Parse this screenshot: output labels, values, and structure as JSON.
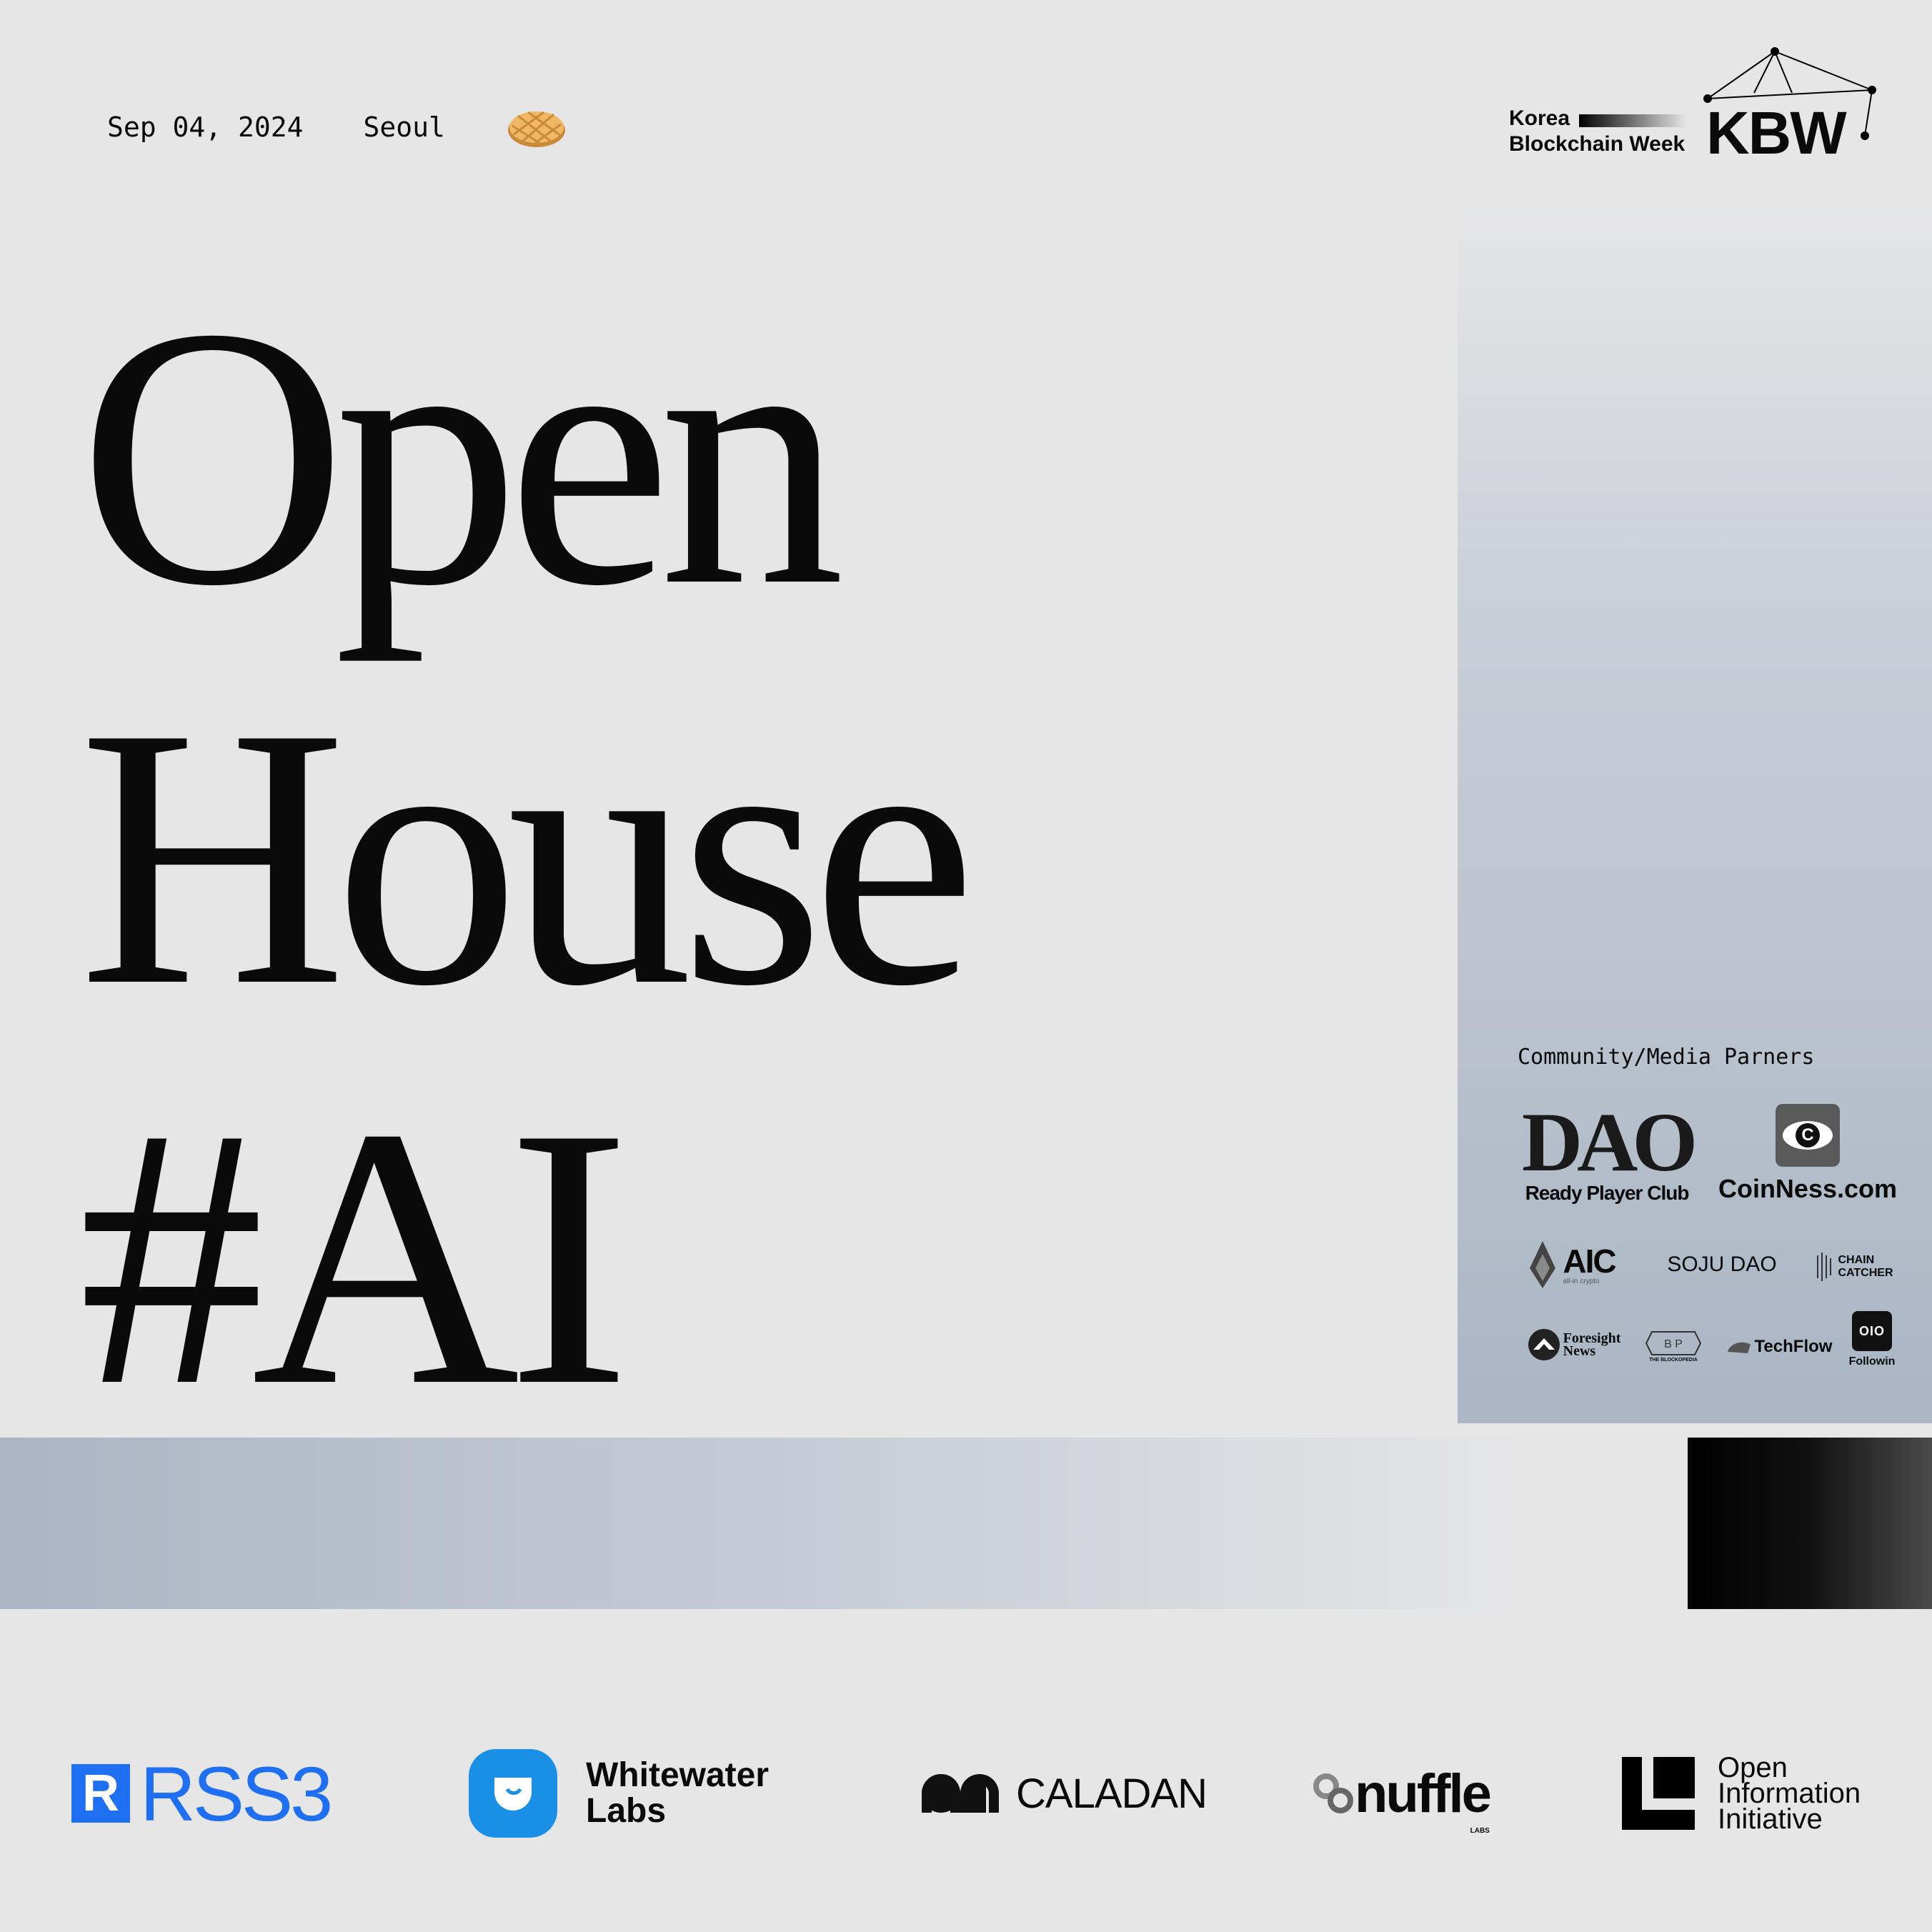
{
  "header": {
    "date": "Sep 04, 2024",
    "city": "Seoul",
    "icon": "waffle-icon",
    "logo": {
      "line1": "Korea",
      "line2": "Blockchain Week",
      "mark": "KBW"
    }
  },
  "title": {
    "line1": "Open",
    "line2": "House",
    "line3": "#AI"
  },
  "partners": {
    "title": "Community/Media Parners",
    "items": [
      {
        "name": "Ready Player Club",
        "mark": "DAO"
      },
      {
        "name": "CoinNess.com",
        "mark": "C"
      },
      {
        "name": "AIC",
        "sub": "all-in crypto"
      },
      {
        "name": "SOJU DAO"
      },
      {
        "name": "CHAIN",
        "name2": "CATCHER"
      },
      {
        "name": "Foresight",
        "name2": "News"
      },
      {
        "name": "THE BLOCKOPEDIA",
        "mark": "B P"
      },
      {
        "name": "TechFlow"
      },
      {
        "name": "Followin",
        "mark": "OIO"
      }
    ]
  },
  "sponsors": [
    {
      "name": "RSS3",
      "mark": "R"
    },
    {
      "name": "Whitewater",
      "name2": "Labs"
    },
    {
      "name": "CALADAN"
    },
    {
      "name": "nuffle",
      "sub": "LABS"
    },
    {
      "name": "Open",
      "name2": "Information",
      "name3": "Initiative"
    }
  ],
  "colors": {
    "background": "#e6e6e7",
    "panel": "#aab6c4",
    "rss3_blue": "#1f6ff2",
    "whitewater_blue": "#1a8fe6",
    "text": "#0a0a0a"
  }
}
